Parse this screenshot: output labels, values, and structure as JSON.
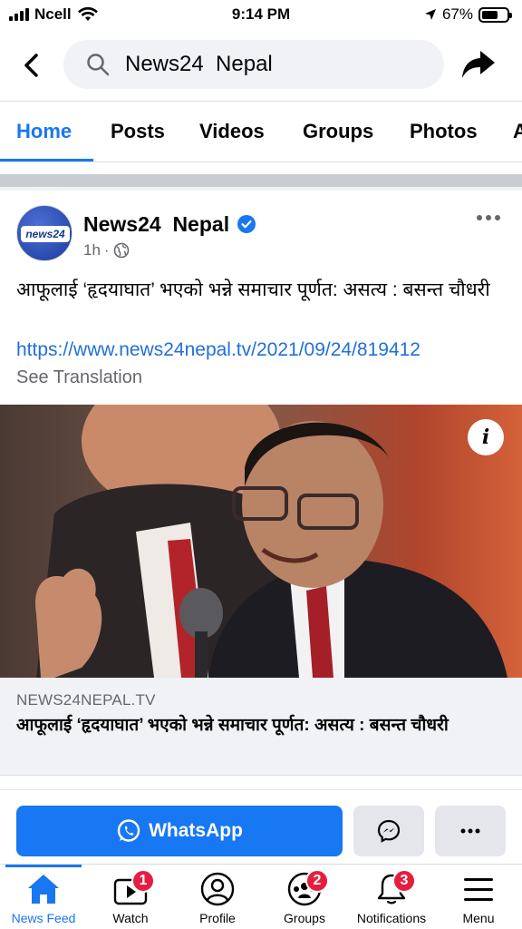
{
  "status_bar": {
    "carrier": "Ncell",
    "time": "9:14 PM",
    "battery": "67%"
  },
  "search": {
    "query": "News24  Nepal"
  },
  "tabs": [
    {
      "label": "Home",
      "active": true
    },
    {
      "label": "Posts",
      "active": false
    },
    {
      "label": "Videos",
      "active": false
    },
    {
      "label": "Groups",
      "active": false
    },
    {
      "label": "Photos",
      "active": false
    },
    {
      "label": "A",
      "active": false
    }
  ],
  "post": {
    "page_name": "News24  Nepal",
    "avatar_text": "news24",
    "time": "1h",
    "separator": "·",
    "text": "आफूलाई ‘हृदयाघात’ भएको भन्ने समाचार पूर्णत: असत्य : बसन्त चौधरी",
    "link": "https://www.news24nepal.tv/2021/09/24/819412",
    "see_translation": "See Translation",
    "link_preview": {
      "domain": "NEWS24NEPAL.TV",
      "title": "आफूलाई ‘हृदयाघात’ भएको भन्ने समाचार पूर्णत: असत्य : बसन्त चौधरी",
      "info_symbol": "i"
    }
  },
  "actions": {
    "whatsapp_label": "WhatsApp"
  },
  "bottom_nav": {
    "items": [
      {
        "label": "News Feed",
        "icon": "home-icon",
        "active": true
      },
      {
        "label": "Watch",
        "icon": "watch-icon",
        "badge": "1"
      },
      {
        "label": "Profile",
        "icon": "profile-icon"
      },
      {
        "label": "Groups",
        "icon": "groups-icon",
        "badge": "2"
      },
      {
        "label": "Notifications",
        "icon": "bell-icon",
        "badge": "3"
      },
      {
        "label": "Menu",
        "icon": "menu-icon"
      }
    ]
  },
  "colors": {
    "accent": "#1877f2",
    "badge": "#e41e3f",
    "link": "#216fdb"
  }
}
